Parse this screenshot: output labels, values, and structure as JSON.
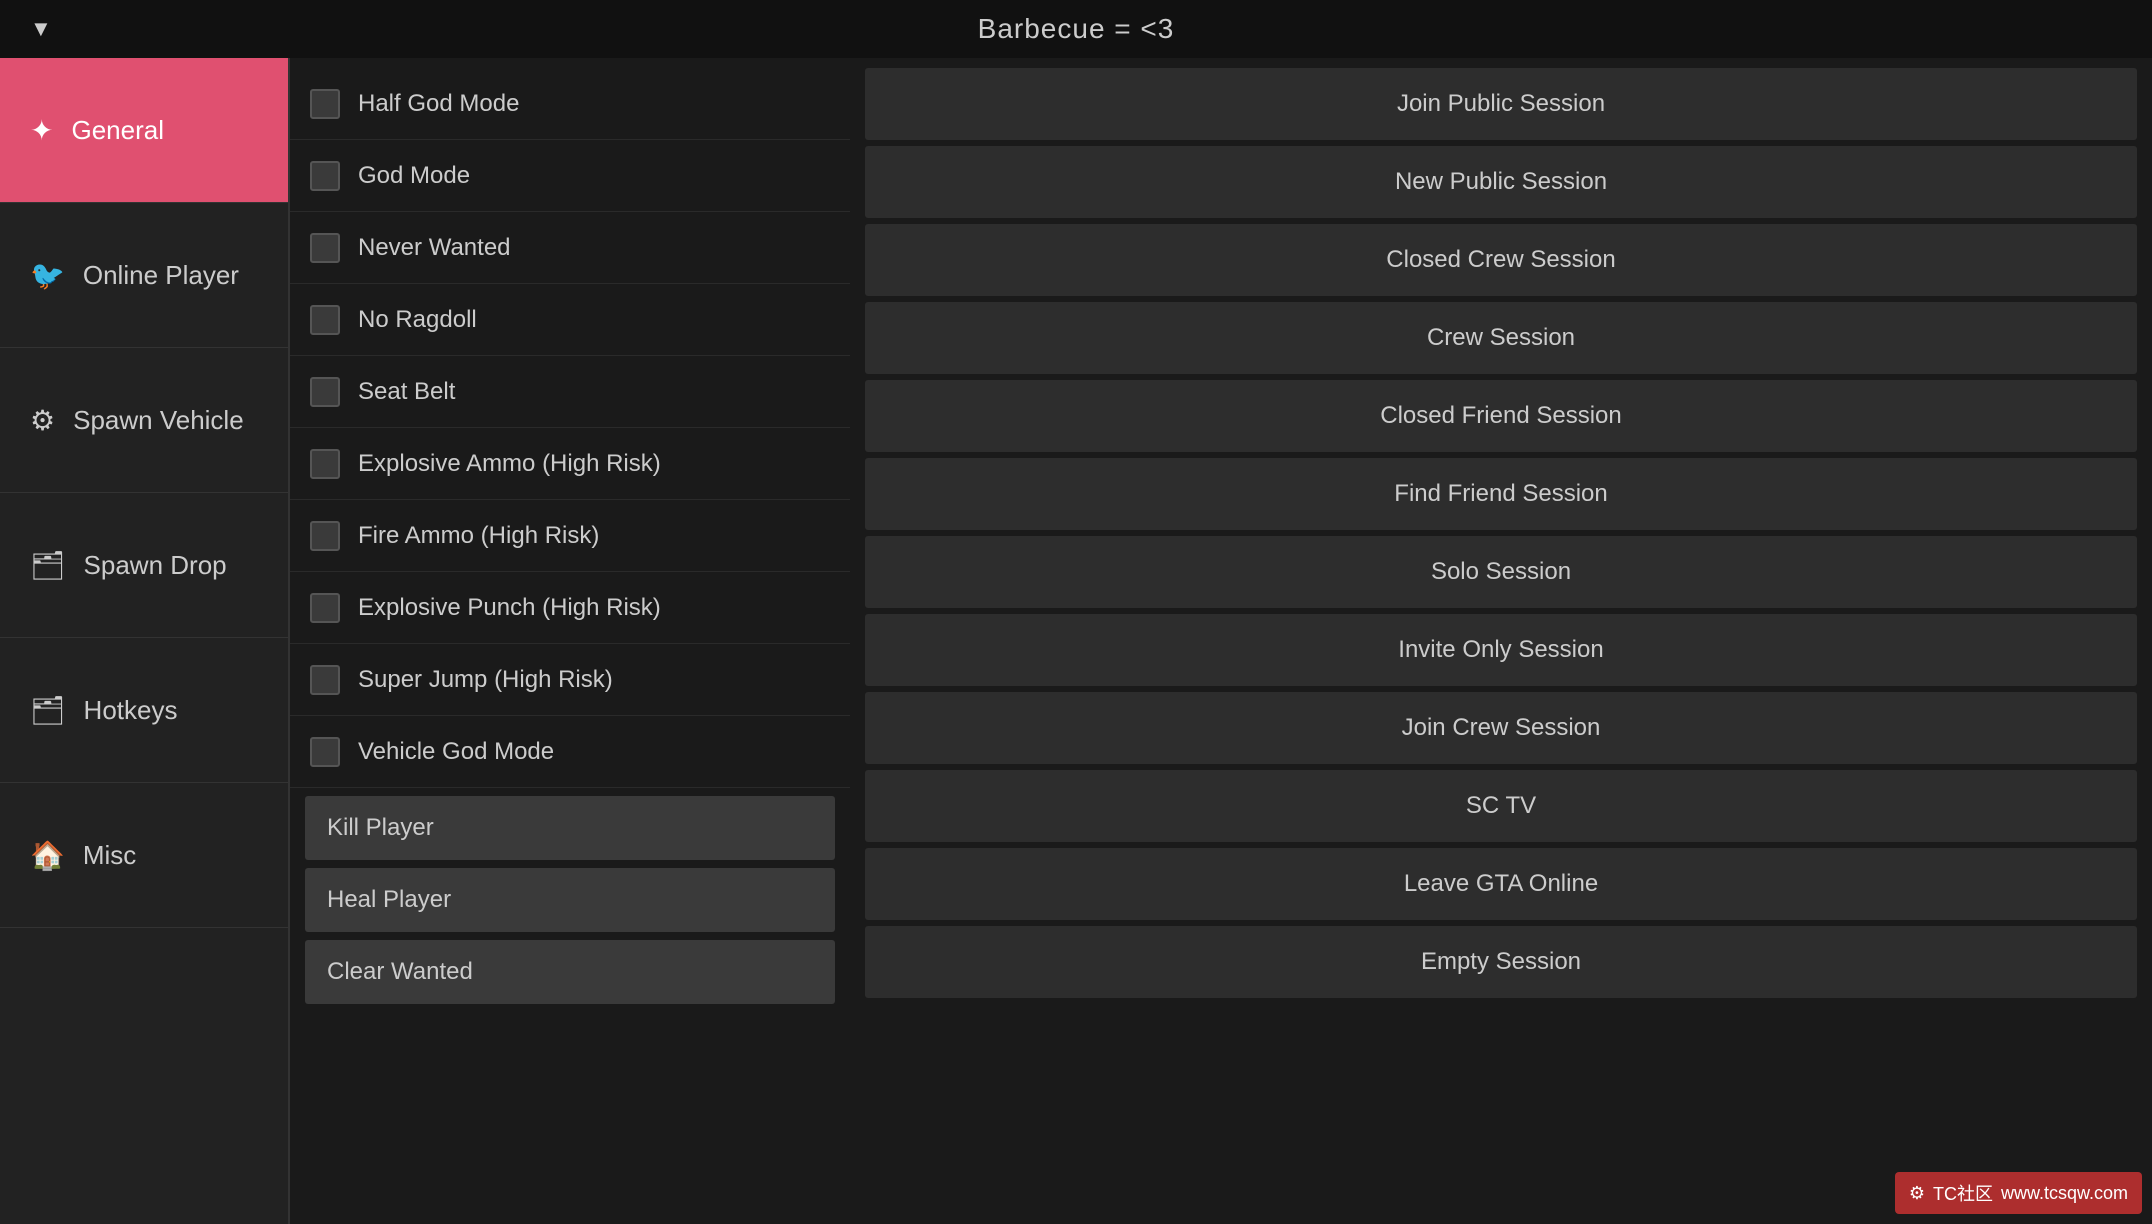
{
  "header": {
    "title": "Barbecue = <3",
    "arrow": "▼"
  },
  "sidebar": {
    "items": [
      {
        "id": "general",
        "label": "General",
        "icon": "⚙",
        "active": true
      },
      {
        "id": "online-player",
        "label": "Online Player",
        "icon": "🐦",
        "active": false
      },
      {
        "id": "spawn-vehicle",
        "label": "Spawn Vehicle",
        "icon": "⚙",
        "active": false
      },
      {
        "id": "spawn-drop",
        "label": "Spawn Drop",
        "icon": "🗂",
        "active": false
      },
      {
        "id": "hotkeys",
        "label": "Hotkeys",
        "icon": "🗂",
        "active": false
      },
      {
        "id": "misc",
        "label": "Misc",
        "icon": "🏠",
        "active": false
      }
    ]
  },
  "toggles": [
    {
      "id": "half-god-mode",
      "label": "Half God Mode",
      "checked": false
    },
    {
      "id": "god-mode",
      "label": "God Mode",
      "checked": false
    },
    {
      "id": "never-wanted",
      "label": "Never Wanted",
      "checked": false
    },
    {
      "id": "no-ragdoll",
      "label": "No Ragdoll",
      "checked": false
    },
    {
      "id": "seat-belt",
      "label": "Seat Belt",
      "checked": false
    },
    {
      "id": "explosive-ammo",
      "label": "Explosive Ammo (High Risk)",
      "checked": false
    },
    {
      "id": "fire-ammo",
      "label": "Fire Ammo (High Risk)",
      "checked": false
    },
    {
      "id": "explosive-punch",
      "label": "Explosive Punch (High Risk)",
      "checked": false
    },
    {
      "id": "super-jump",
      "label": "Super Jump (High Risk)",
      "checked": false
    },
    {
      "id": "vehicle-god-mode",
      "label": "Vehicle God Mode",
      "checked": false
    }
  ],
  "action_buttons": [
    {
      "id": "kill-player",
      "label": "Kill Player"
    },
    {
      "id": "heal-player",
      "label": "Heal Player"
    },
    {
      "id": "clear-wanted",
      "label": "Clear Wanted"
    }
  ],
  "session_buttons": [
    {
      "id": "join-public-session",
      "label": "Join Public Session"
    },
    {
      "id": "new-public-session",
      "label": "New Public Session"
    },
    {
      "id": "closed-crew-session",
      "label": "Closed Crew Session"
    },
    {
      "id": "crew-session",
      "label": "Crew Session"
    },
    {
      "id": "closed-friend-session",
      "label": "Closed Friend Session"
    },
    {
      "id": "find-friend-session",
      "label": "Find Friend Session"
    },
    {
      "id": "solo-session",
      "label": "Solo Session"
    },
    {
      "id": "invite-only-session",
      "label": "Invite Only Session"
    },
    {
      "id": "join-crew-session",
      "label": "Join Crew Session"
    },
    {
      "id": "sc-tv",
      "label": "SC TV"
    },
    {
      "id": "leave-gta-online",
      "label": "Leave GTA Online"
    },
    {
      "id": "empty-session",
      "label": "Empty Session"
    }
  ],
  "watermark": {
    "text": "TC社区",
    "url_text": "www.tcsqw.com"
  },
  "colors": {
    "active_bg": "#e05070",
    "sidebar_bg": "#222222",
    "content_bg": "#1a1a1a",
    "button_bg": "#2d2d2d",
    "action_button_bg": "#3a3a3a"
  }
}
